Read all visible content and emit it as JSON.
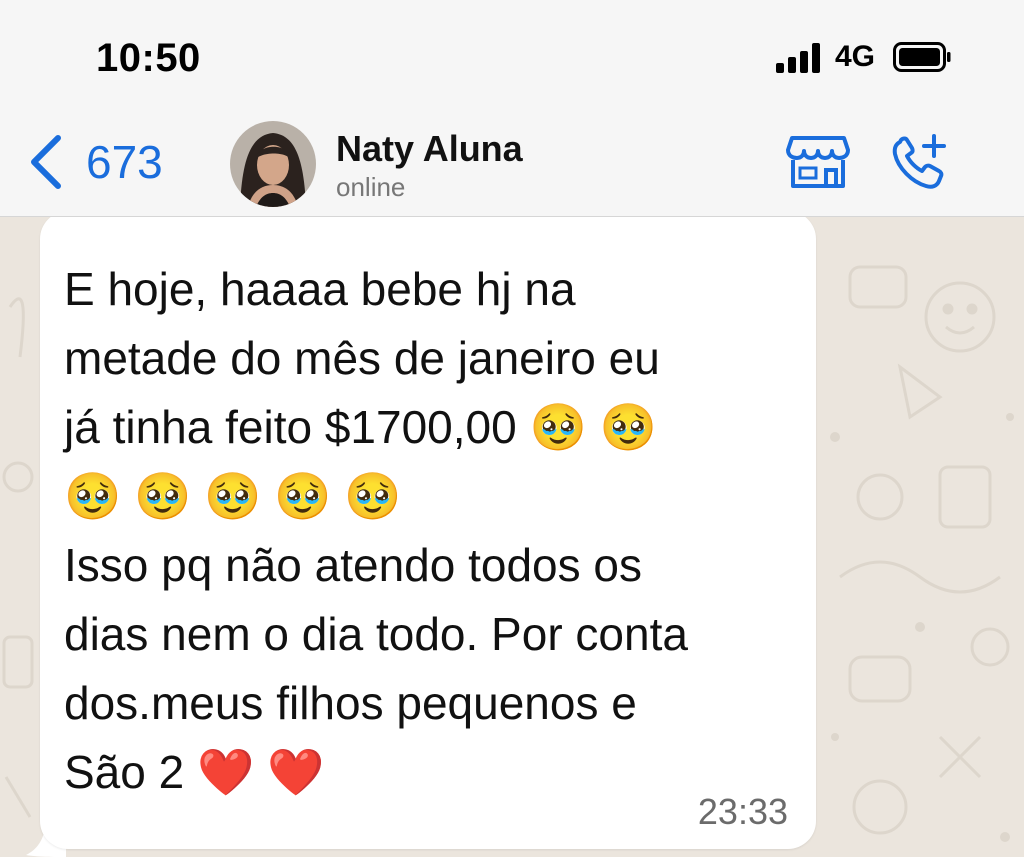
{
  "status_bar": {
    "time": "10:50",
    "network": "4G",
    "icons": [
      "signal-icon",
      "battery-icon"
    ]
  },
  "header": {
    "back_count": "673",
    "contact_name": "Naty Aluna",
    "contact_status": "online",
    "icons": [
      "back-chevron-icon",
      "store-icon",
      "call-add-icon"
    ],
    "accent_color": "#1a6ddc"
  },
  "message": {
    "text": "E hoje, haaaa bebe hj na\nmetade do mês de janeiro eu\njá tinha feito $1700,00 🥹 🥹\n🥹 🥹 🥹 🥹 🥹\nIsso pq não atendo todos os\ndias nem o dia todo. Por conta\ndos.meus filhos pequenos e\nSão 2 ❤️ ❤️",
    "time": "23:33"
  },
  "colors": {
    "chat_background": "#ebe5dd",
    "bubble": "#ffffff",
    "header_background": "#f6f6f6"
  }
}
